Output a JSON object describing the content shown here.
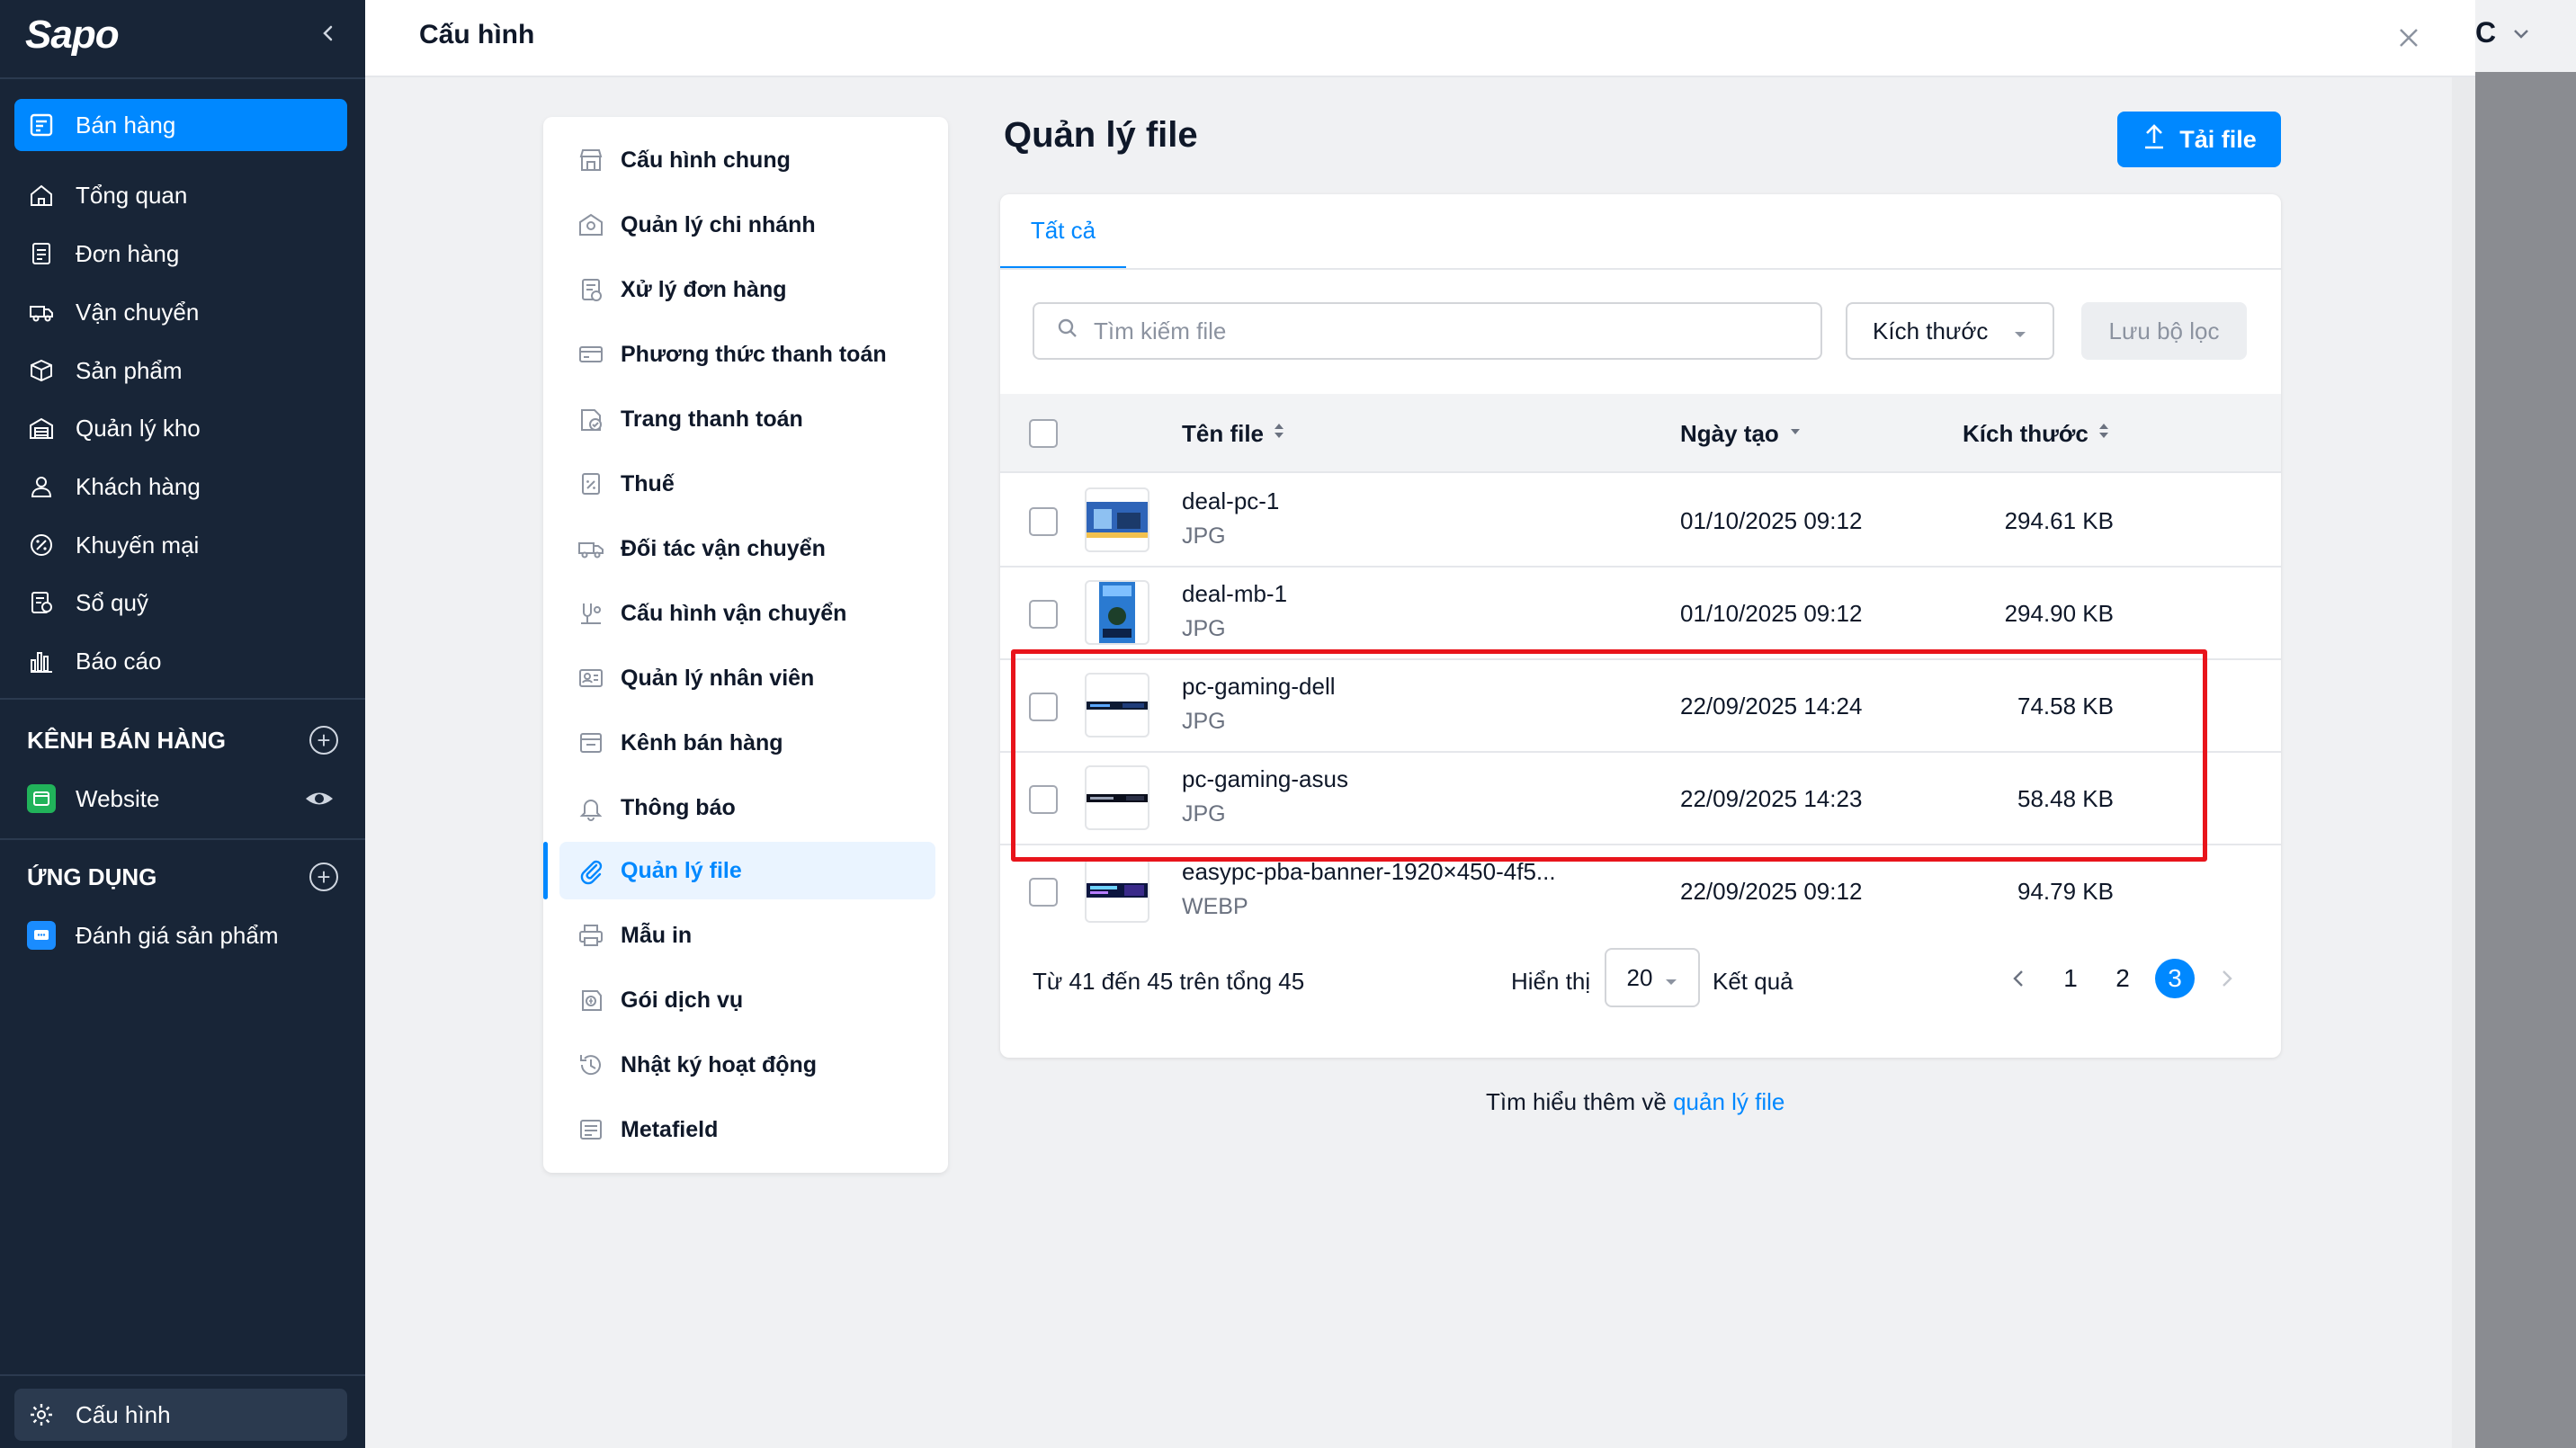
{
  "sidebar": {
    "logo": "Sapo",
    "items": [
      {
        "label": "Bán hàng",
        "icon": "pos-icon",
        "active": true
      },
      {
        "label": "Tổng quan",
        "icon": "home-icon"
      },
      {
        "label": "Đơn hàng",
        "icon": "orders-icon"
      },
      {
        "label": "Vận chuyển",
        "icon": "truck-icon"
      },
      {
        "label": "Sản phẩm",
        "icon": "box-icon"
      },
      {
        "label": "Quản lý kho",
        "icon": "warehouse-icon"
      },
      {
        "label": "Khách hàng",
        "icon": "user-icon"
      },
      {
        "label": "Khuyến mại",
        "icon": "discount-icon"
      },
      {
        "label": "Sổ quỹ",
        "icon": "cashbook-icon"
      },
      {
        "label": "Báo cáo",
        "icon": "chart-icon"
      }
    ],
    "channels_heading": "KÊNH BÁN HÀNG",
    "channels": [
      {
        "label": "Website",
        "icon": "website-icon"
      }
    ],
    "apps_heading": "ỨNG DỤNG",
    "apps": [
      {
        "label": "Đánh giá sản phẩm",
        "icon": "review-icon"
      }
    ],
    "settings_label": "Cấu hình"
  },
  "background": {
    "partial_text": "C"
  },
  "modal": {
    "title": "Cấu hình",
    "menu": [
      {
        "label": "Cấu hình chung",
        "icon": "store-icon"
      },
      {
        "label": "Quản lý chi nhánh",
        "icon": "branch-icon"
      },
      {
        "label": "Xử lý đơn hàng",
        "icon": "order-process-icon"
      },
      {
        "label": "Phương thức thanh toán",
        "icon": "card-icon"
      },
      {
        "label": "Trang thanh toán",
        "icon": "checkout-icon"
      },
      {
        "label": "Thuế",
        "icon": "tax-icon"
      },
      {
        "label": "Đối tác vận chuyển",
        "icon": "shipping-partner-icon"
      },
      {
        "label": "Cấu hình vận chuyển",
        "icon": "shipping-config-icon"
      },
      {
        "label": "Quản lý nhân viên",
        "icon": "staff-icon"
      },
      {
        "label": "Kênh bán hàng",
        "icon": "channel-icon"
      },
      {
        "label": "Thông báo",
        "icon": "bell-icon"
      },
      {
        "label": "Quản lý file",
        "icon": "paperclip-icon",
        "active": true
      },
      {
        "label": "Mẫu in",
        "icon": "printer-icon"
      },
      {
        "label": "Gói dịch vụ",
        "icon": "package-icon"
      },
      {
        "label": "Nhật ký hoạt động",
        "icon": "history-icon"
      },
      {
        "label": "Metafield",
        "icon": "metafield-icon"
      }
    ],
    "page_title": "Quản lý file",
    "upload_label": "Tải file",
    "tab_all": "Tất cả",
    "search_placeholder": "Tìm kiếm file",
    "size_filter": "Kích thước",
    "save_filter": "Lưu bộ lọc",
    "columns": {
      "name": "Tên file",
      "date": "Ngày tạo",
      "size": "Kích thước"
    },
    "files": [
      {
        "name": "deal-pc-1",
        "type": "JPG",
        "date": "01/10/2025 09:12",
        "size": "294.61 KB"
      },
      {
        "name": "deal-mb-1",
        "type": "JPG",
        "date": "01/10/2025 09:12",
        "size": "294.90 KB"
      },
      {
        "name": "pc-gaming-dell",
        "type": "JPG",
        "date": "22/09/2025 14:24",
        "size": "74.58 KB"
      },
      {
        "name": "pc-gaming-asus",
        "type": "JPG",
        "date": "22/09/2025 14:23",
        "size": "58.48 KB"
      },
      {
        "name": "easypc-pba-banner-1920×450-4f5...",
        "type": "WEBP",
        "date": "22/09/2025 09:12",
        "size": "94.79 KB"
      }
    ],
    "pagination": {
      "range_text": "Từ 41 đến 45 trên tổng 45",
      "show_label": "Hiển thị",
      "page_size": "20",
      "result_label": "Kết quả",
      "pages": [
        "1",
        "2",
        "3"
      ],
      "current_page": "3"
    },
    "learn_more_prefix": "Tìm hiểu thêm về ",
    "learn_more_link": "quản lý file"
  },
  "colors": {
    "accent": "#0088ff",
    "sidebar": "#182537",
    "highlight": "#e8141b"
  }
}
